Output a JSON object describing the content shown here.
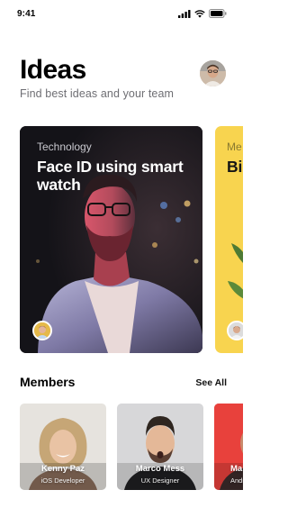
{
  "status_bar": {
    "time": "9:41"
  },
  "header": {
    "title": "Ideas",
    "subtitle": "Find best ideas and your team"
  },
  "cards": [
    {
      "category": "Technology",
      "title": "Face ID using smart watch"
    },
    {
      "category": "Me",
      "title": "Bi fo"
    }
  ],
  "members_section": {
    "title": "Members",
    "see_all": "See All",
    "members": [
      {
        "name": "Kenny Paz",
        "role": "iOS Developer"
      },
      {
        "name": "Marco Mess",
        "role": "UX Designer"
      },
      {
        "name": "Ma",
        "role": "Andr"
      }
    ]
  },
  "colors": {
    "accent_yellow": "#f8d44f",
    "dark_card": "#1d1c21",
    "subtitle_gray": "#6e6e73",
    "member_red": "#e8413c"
  }
}
